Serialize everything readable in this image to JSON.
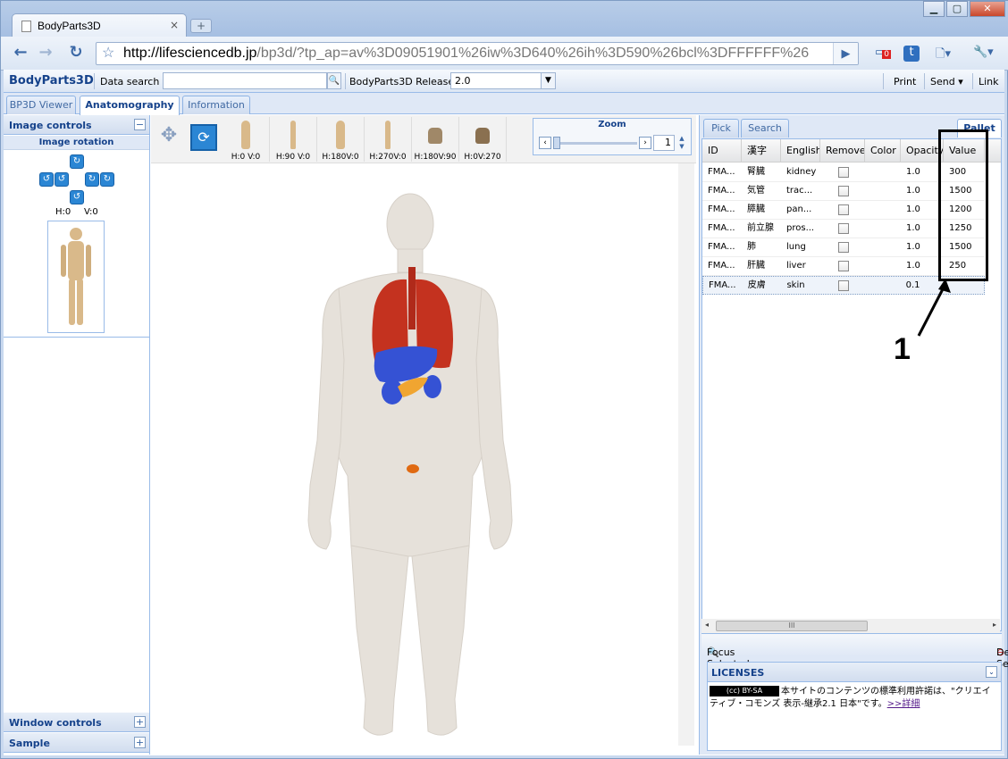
{
  "browser": {
    "tab_title": "BodyParts3D",
    "tab_close": "×",
    "newtab": "+",
    "url_host": "http://lifesciencedb.jp",
    "url_rest": "/bp3d/?tp_ap=av%3D09051901%26iw%3D640%26ih%3D590%26bcl%3DFFFFFF%26",
    "extension_badge": "0"
  },
  "app": {
    "brand": "BodyParts3D",
    "data_search_label": "Data search :",
    "release_label": "BodyParts3D Release :",
    "release_value": "2.0",
    "header_links": [
      "Print",
      "Send ▾",
      "Link"
    ],
    "tabs": [
      "BP3D Viewer",
      "Anatomography",
      "Information"
    ],
    "active_tab": "Anatomography"
  },
  "left_panel": {
    "image_controls": "Image controls",
    "image_rotation": "Image rotation",
    "rotation_h": "H:0",
    "rotation_v": "V:0",
    "window_controls": "Window controls",
    "sample": "Sample"
  },
  "view": {
    "presets": [
      "H:0 V:0",
      "H:90 V:0",
      "H:180V:0",
      "H:270V:0",
      "H:180V:90",
      "H:0V:270"
    ],
    "zoom_title": "Zoom",
    "zoom_value": "1"
  },
  "right_panel": {
    "tabs": [
      "Pick",
      "Search",
      "Pallet"
    ],
    "columns": [
      "ID",
      "漢字",
      "English",
      "Remove",
      "Color",
      "Opacity",
      "Value"
    ],
    "rows": [
      {
        "id": "FMA...",
        "kanji": "腎臓",
        "english": "kidney",
        "opacity": "1.0",
        "value": "300"
      },
      {
        "id": "FMA...",
        "kanji": "気管",
        "english": "trac...",
        "opacity": "1.0",
        "value": "1500"
      },
      {
        "id": "FMA...",
        "kanji": "膵臓",
        "english": "pan...",
        "opacity": "1.0",
        "value": "1200"
      },
      {
        "id": "FMA...",
        "kanji": "前立腺",
        "english": "pros...",
        "opacity": "1.0",
        "value": "1250"
      },
      {
        "id": "FMA...",
        "kanji": "肺",
        "english": "lung",
        "opacity": "1.0",
        "value": "1500"
      },
      {
        "id": "FMA...",
        "kanji": "肝臓",
        "english": "liver",
        "opacity": "1.0",
        "value": "250"
      },
      {
        "id": "FMA...",
        "kanji": "皮膚",
        "english": "skin",
        "opacity": "0.1",
        "value": ""
      }
    ],
    "focus_selected": "Focus Selected",
    "delete_selected": "Delete Selected",
    "licenses_title": "LICENSES",
    "cc_badge": "(cc) BY-SA",
    "license_text": "本サイトのコンテンツの標準利用許諾は、\"クリエイティブ・コモンズ 表示-継承2.1 日本\"です。",
    "license_link": ">>詳細"
  },
  "annotation": {
    "label": "1"
  }
}
